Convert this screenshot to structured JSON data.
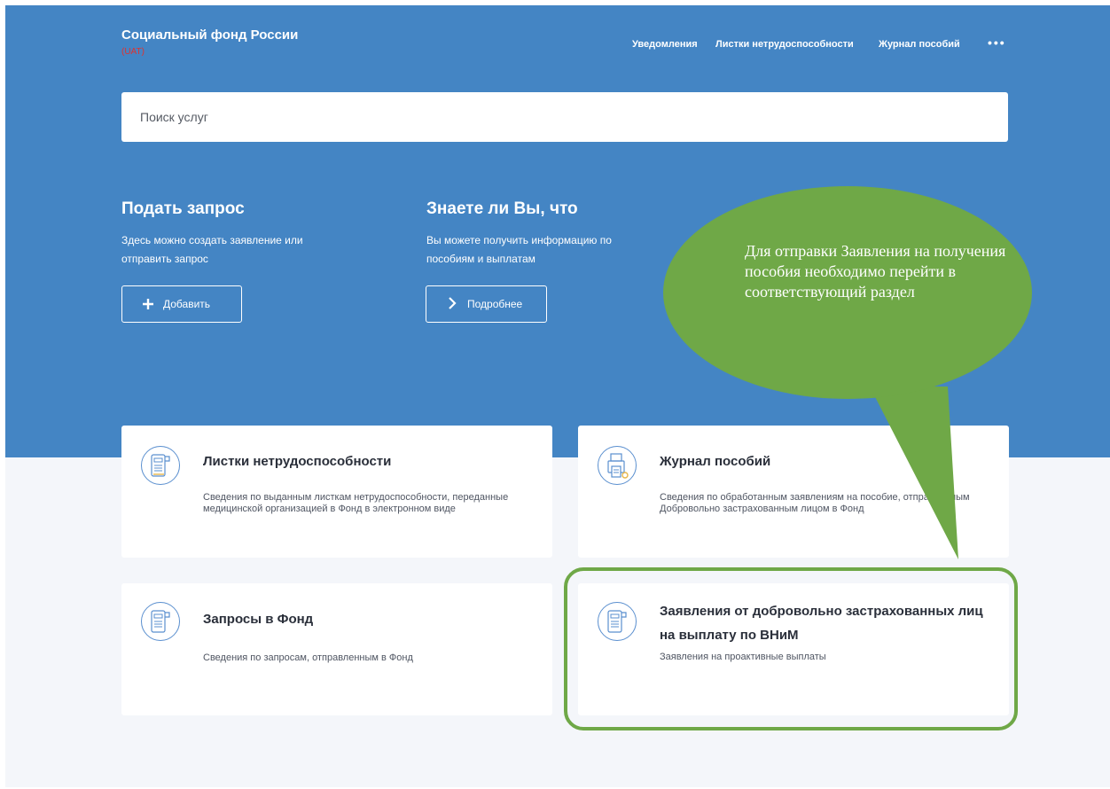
{
  "header": {
    "title": "Социальный фонд России",
    "env": "(UAT)",
    "nav": [
      {
        "label": "Уведомления"
      },
      {
        "label": "Листки нетрудоспособности"
      },
      {
        "label": "Журнал пособий"
      }
    ],
    "more": "•••"
  },
  "search": {
    "placeholder": "Поиск услуг"
  },
  "promo": [
    {
      "title": "Подать запрос",
      "text": "Здесь можно создать заявление или отправить запрос",
      "button": "Добавить",
      "icon": "plus-icon"
    },
    {
      "title": "Знаете ли Вы, что",
      "text": "Вы можете получить информацию по пособиям и выплатам",
      "button": "Подробнее",
      "icon": "chevron-right-icon"
    }
  ],
  "cards": [
    {
      "title": "Листки нетрудоспособности",
      "desc": "Сведения по выданным листкам нетрудоспособности, переданные медицинской организацией в Фонд в электронном виде",
      "icon": "document-icon"
    },
    {
      "title": "Журнал пособий",
      "desc": "Сведения по обработанным заявлениям на пособие, отправленным Добровольно застрахованным лицом в Фонд",
      "icon": "printer-icon"
    },
    {
      "title": "Запросы в Фонд",
      "desc": "Сведения по запросам, отправленным в Фонд",
      "icon": "document-icon"
    },
    {
      "title": "Заявления от добровольно застрахованных лиц на выплату по ВНиМ",
      "desc": "Заявления на проактивные выплаты",
      "icon": "document-icon"
    }
  ],
  "callout": {
    "text": "Для отправки Заявления на получения пособия необходимо перейти в соответствующий раздел",
    "color": "#6fa847"
  },
  "colors": {
    "hero": "#4485c4",
    "accent": "#6fa847",
    "env": "#e0322f"
  }
}
